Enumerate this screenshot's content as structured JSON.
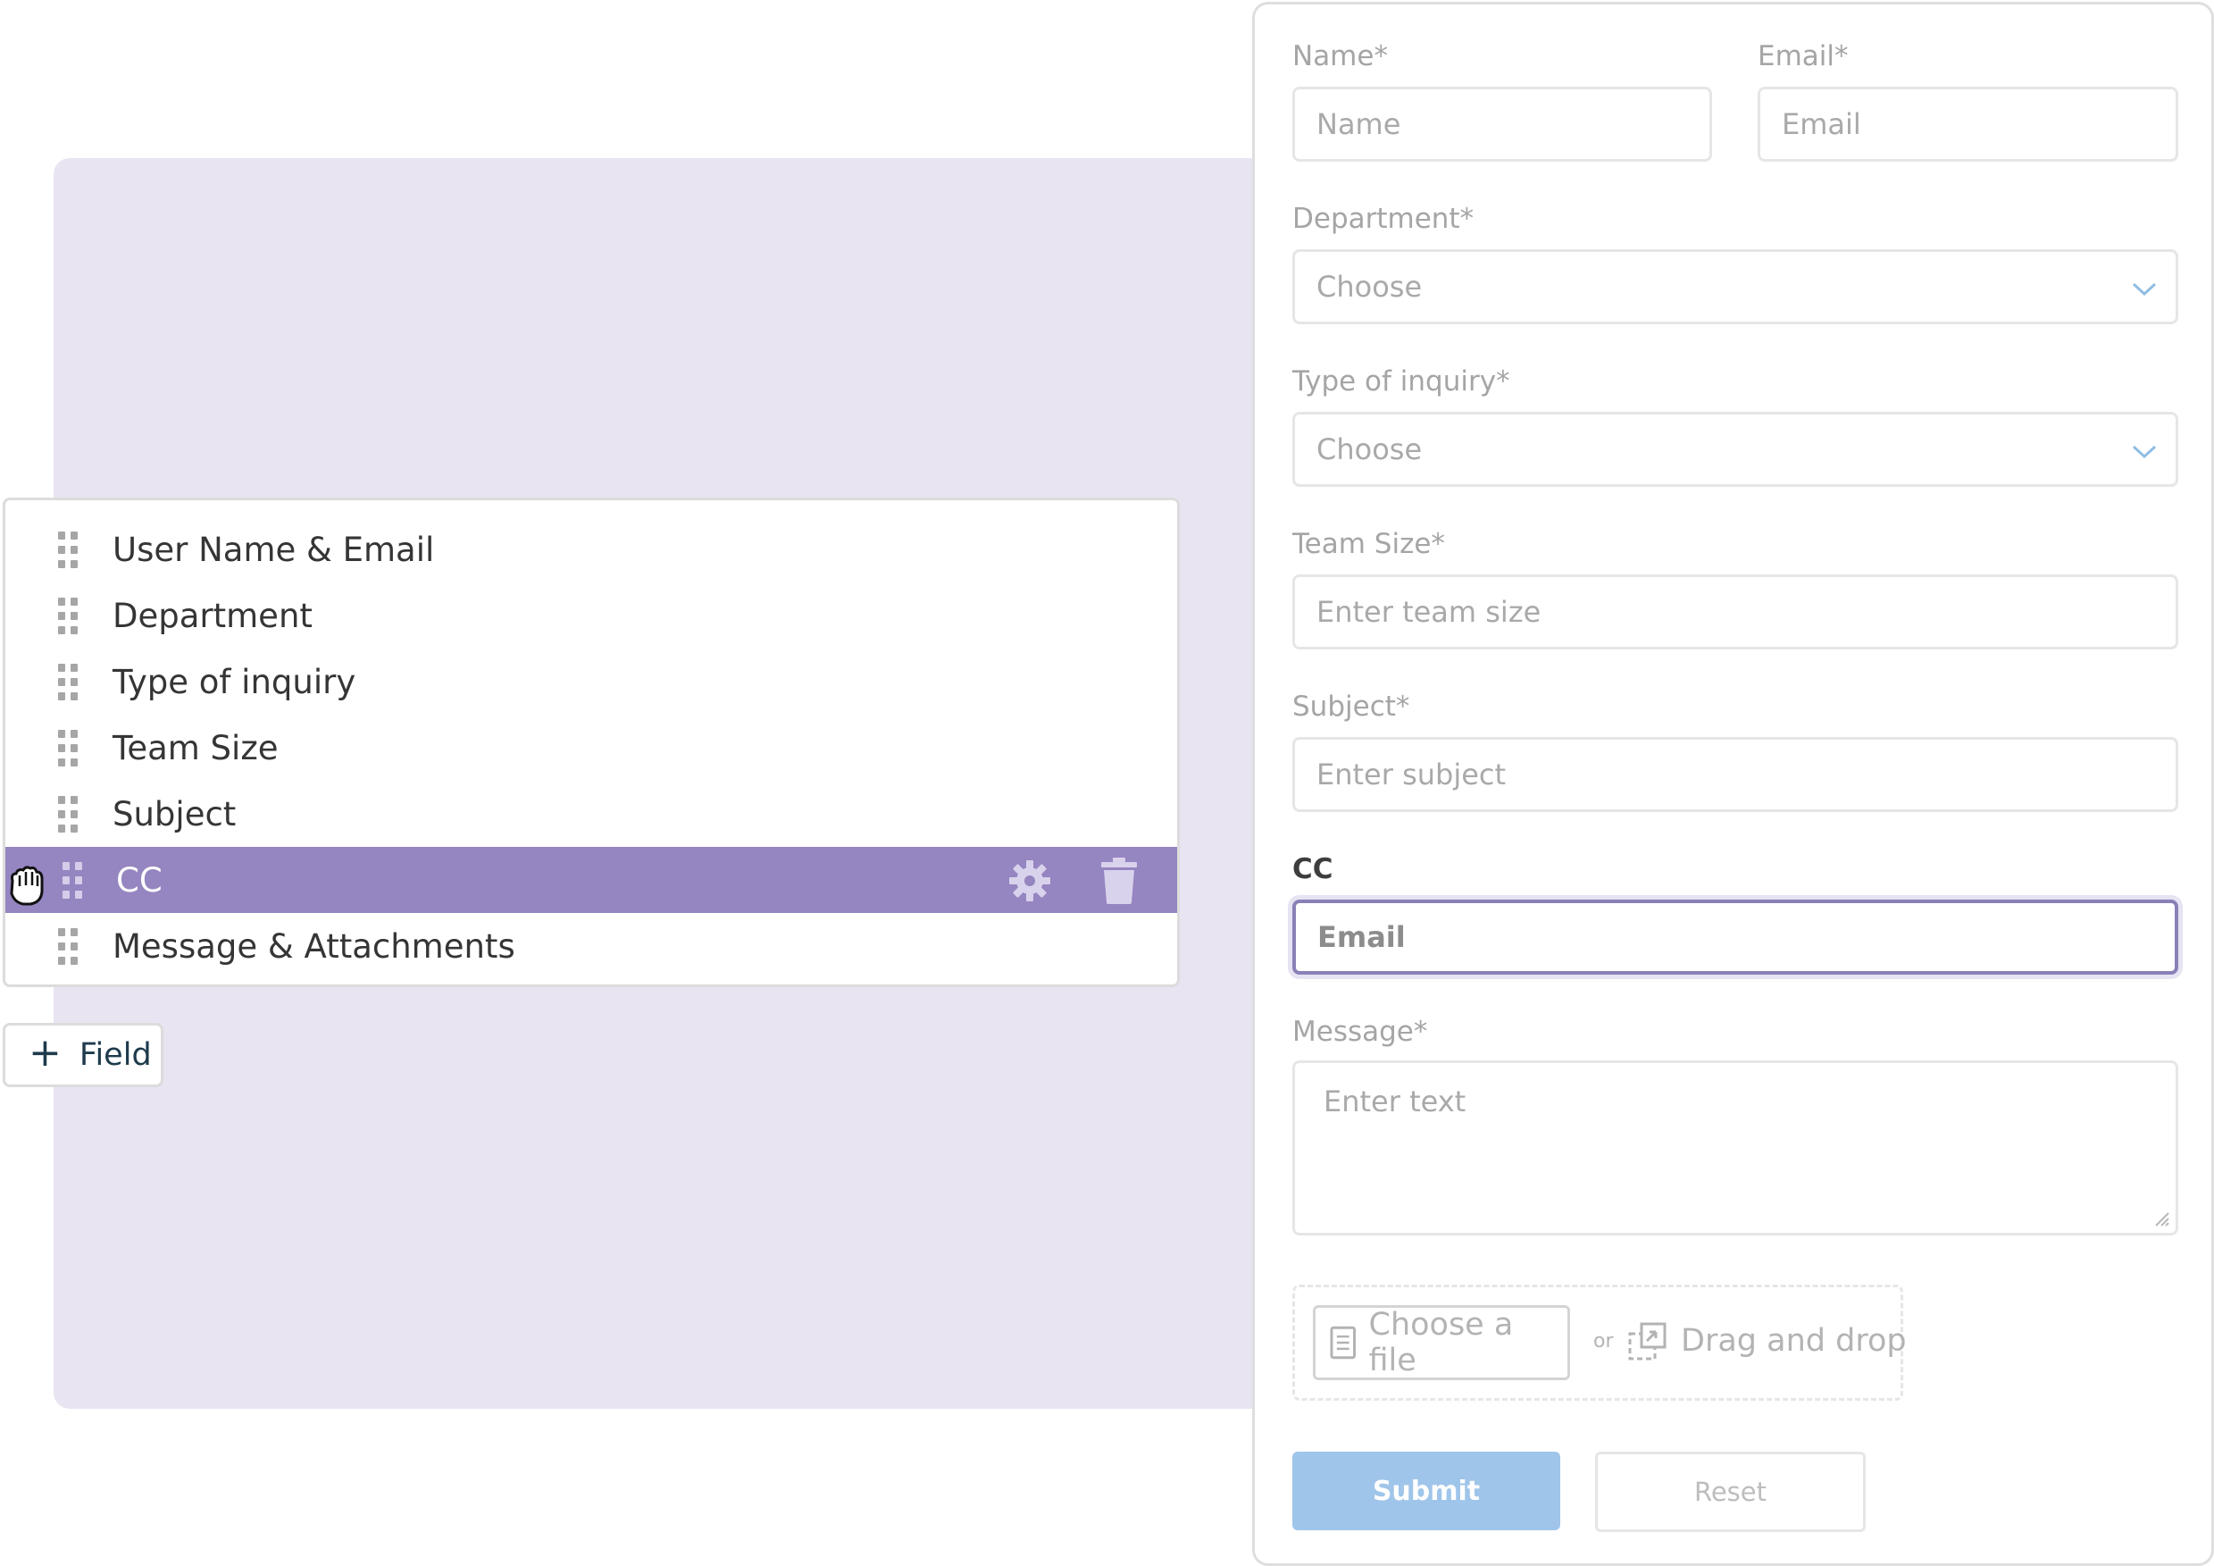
{
  "builder": {
    "fields": [
      {
        "label": "User Name & Email",
        "selected": false
      },
      {
        "label": "Department",
        "selected": false
      },
      {
        "label": "Type of inquiry",
        "selected": false
      },
      {
        "label": "Team Size",
        "selected": false
      },
      {
        "label": "Subject",
        "selected": false
      },
      {
        "label": "CC",
        "selected": true
      },
      {
        "label": "Message & Attachments",
        "selected": false
      }
    ],
    "add_field_label": "Field",
    "add_field_icon": "plus-icon",
    "drag_handle_icon": "drag-handle-icon",
    "settings_icon": "gear-icon",
    "delete_icon": "trash-icon",
    "cursor_icon": "grab-hand-cursor-icon",
    "accent_color": "#9585c0",
    "panel_color": "#e9e4f1"
  },
  "form": {
    "name": {
      "label": "Name*",
      "placeholder": "Name"
    },
    "email": {
      "label": "Email*",
      "placeholder": "Email"
    },
    "department": {
      "label": "Department*",
      "value": "Choose"
    },
    "inquiry": {
      "label": "Type of inquiry*",
      "value": "Choose"
    },
    "team_size": {
      "label": "Team Size*",
      "placeholder": "Enter team size"
    },
    "subject": {
      "label": "Subject*",
      "placeholder": "Enter subject"
    },
    "cc": {
      "label": "CC",
      "placeholder": "Email"
    },
    "message": {
      "label": "Message*",
      "placeholder": "Enter text"
    },
    "upload": {
      "choose_label": "Choose a file",
      "or_label": "or",
      "drag_label": "Drag and drop"
    },
    "submit_label": "Submit",
    "reset_label": "Reset",
    "submit_color": "#9fc5ea",
    "focus_color": "#8a80b8"
  }
}
